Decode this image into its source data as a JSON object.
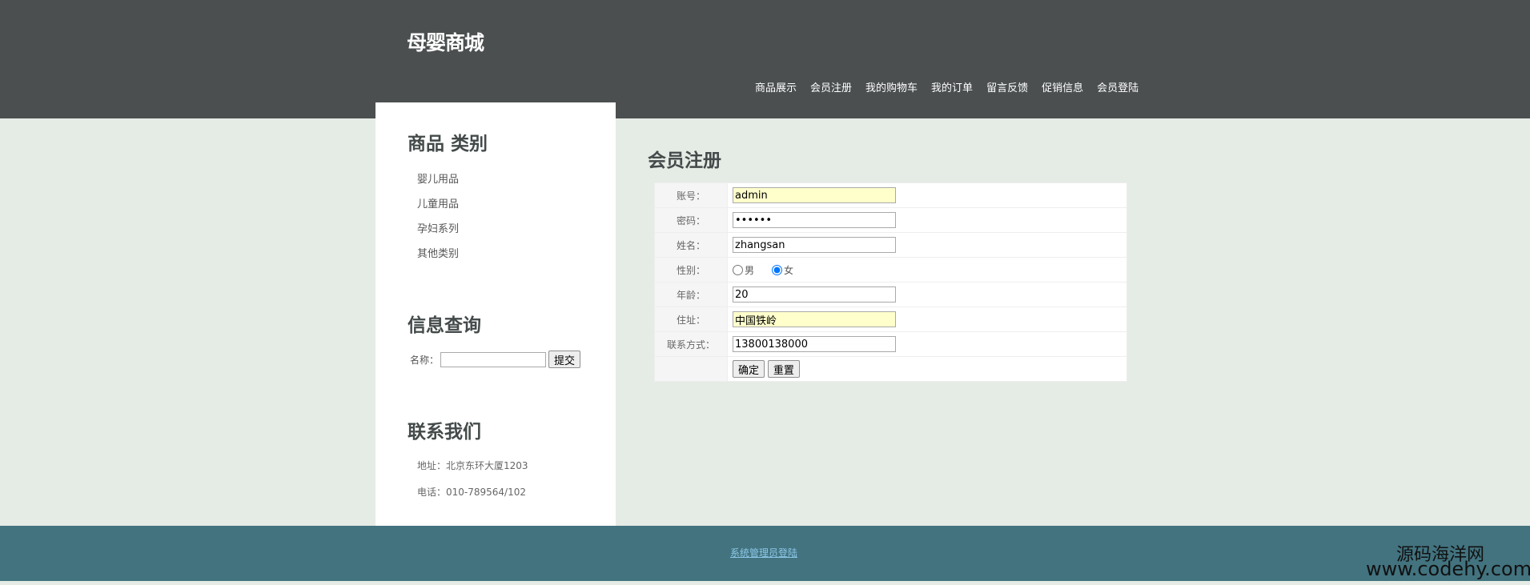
{
  "header": {
    "logo": "母婴商城",
    "nav": [
      "商品展示",
      "会员注册",
      "我的购物车",
      "我的订单",
      "留言反馈",
      "促销信息",
      "会员登陆"
    ]
  },
  "sidebar": {
    "categories_title": "商品 类别",
    "categories": [
      "婴儿用品",
      "儿童用品",
      "孕妇系列",
      "其他类别"
    ],
    "search_title": "信息查询",
    "search_label": "名称：",
    "search_value": "",
    "search_button": "提交",
    "contact_title": "联系我们",
    "address": "地址：北京东环大厦1203",
    "phone": "电话：010-789564/102"
  },
  "main": {
    "title": "会员注册",
    "form": {
      "account_label": "账号：",
      "account_value": "admin",
      "password_label": "密码：",
      "password_value": "••••••",
      "name_label": "姓名：",
      "name_value": "zhangsan",
      "gender_label": "性别：",
      "gender_male": "男",
      "gender_female": "女",
      "gender_selected": "女",
      "age_label": "年龄：",
      "age_value": "20",
      "address_label": "住址：",
      "address_value": "中国铁岭",
      "contact_label": "联系方式：",
      "contact_value": "13800138000",
      "confirm_button": "确定",
      "reset_button": "重置"
    }
  },
  "footer": {
    "admin_link": "系统管理员登陆"
  },
  "watermark": {
    "line1": "源码海洋网",
    "line2": "www.codehy.com"
  }
}
